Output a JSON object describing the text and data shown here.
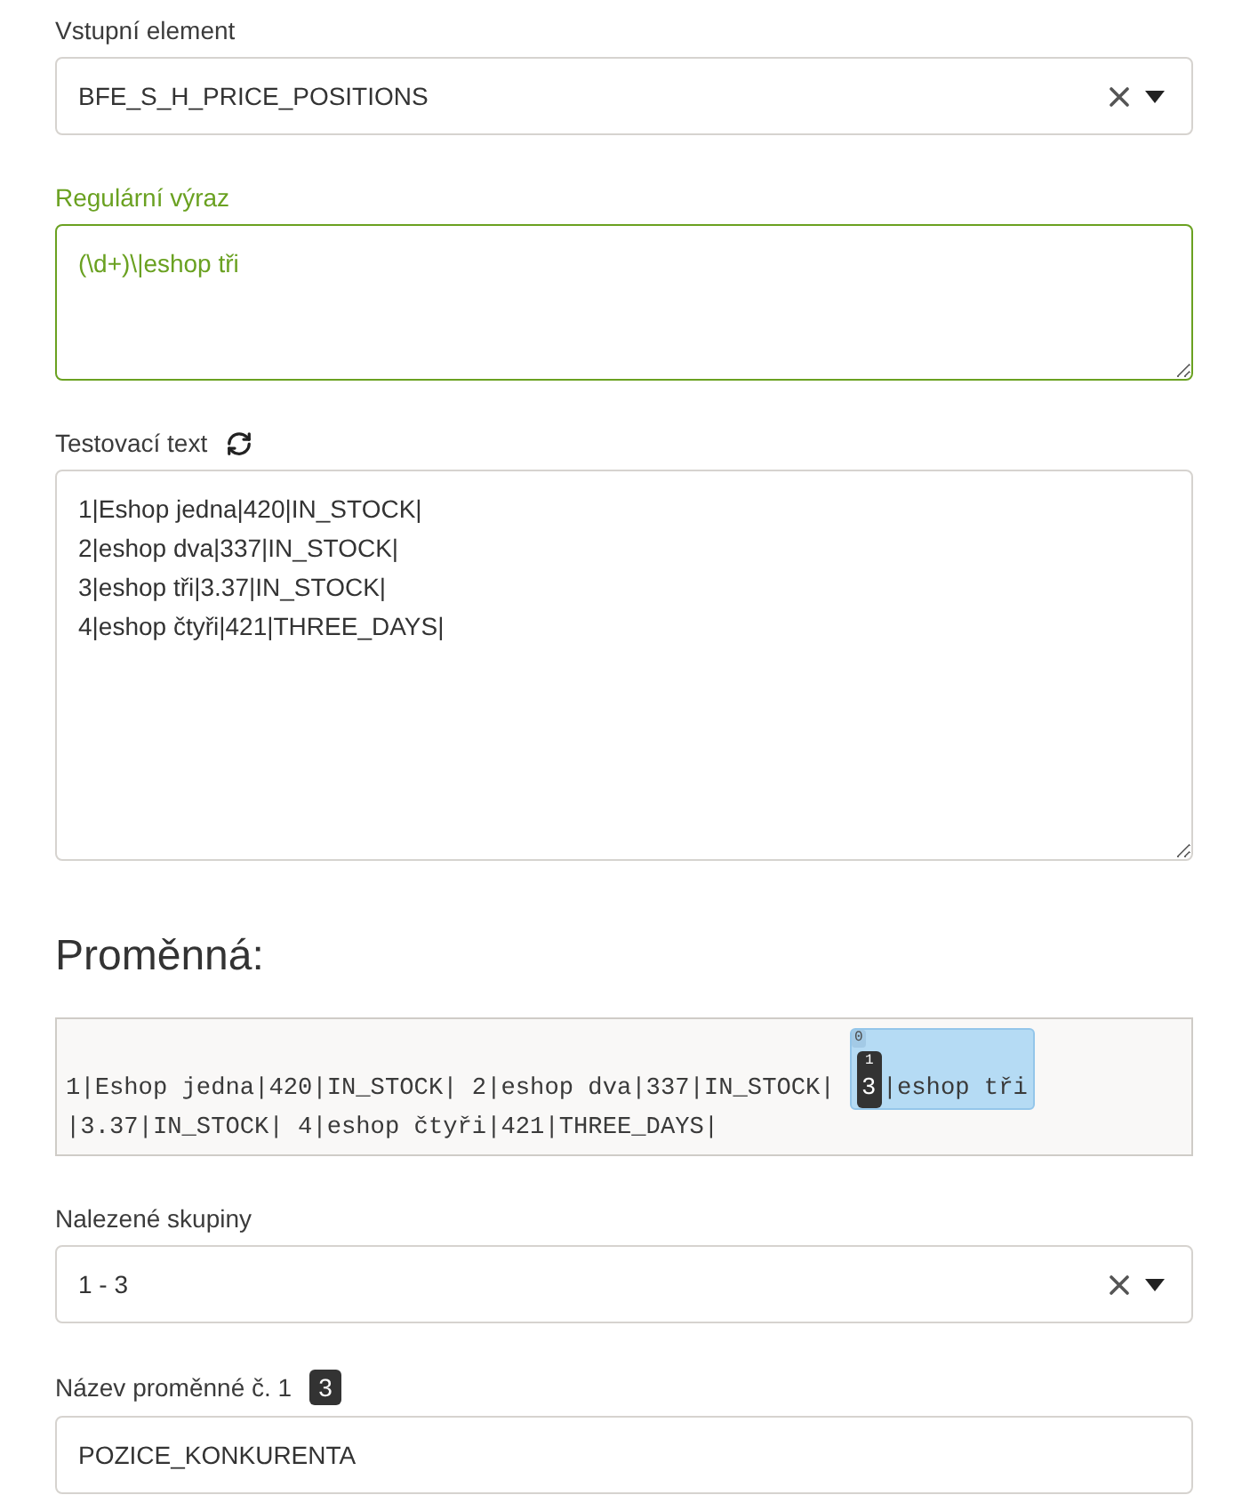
{
  "input_element": {
    "label": "Vstupní element",
    "value": "BFE_S_H_PRICE_POSITIONS"
  },
  "regex": {
    "label": "Regulární výraz",
    "value": "(\\d+)\\|eshop tři",
    "focused": true
  },
  "test_text": {
    "label": "Testovací text",
    "value": "1|Eshop jedna|420|IN_STOCK|\n2|eshop dva|337|IN_STOCK|\n3|eshop tři|3.37|IN_STOCK|\n4|eshop čtyři|421|THREE_DAYS|"
  },
  "variable": {
    "heading": "Proměnná:",
    "segments": [
      {
        "kind": "text",
        "text": "1|Eshop jedna|420|IN_STOCK| 2|eshop dva|337|IN_STOCK| "
      },
      {
        "kind": "match",
        "index": "0",
        "parts": [
          {
            "kind": "group",
            "index": "1",
            "text": "3"
          },
          {
            "kind": "text",
            "text": "|eshop tři"
          }
        ]
      },
      {
        "kind": "text",
        "text": "|3.37|IN_STOCK| 4|eshop čtyři|421|THREE_DAYS|"
      }
    ]
  },
  "found_groups": {
    "label": "Nalezené skupiny",
    "value": "1 - 3"
  },
  "variable_name": {
    "label": "Název proměnné č. 1",
    "badge": "3",
    "value": "POZICE_KONKURENTA"
  }
}
